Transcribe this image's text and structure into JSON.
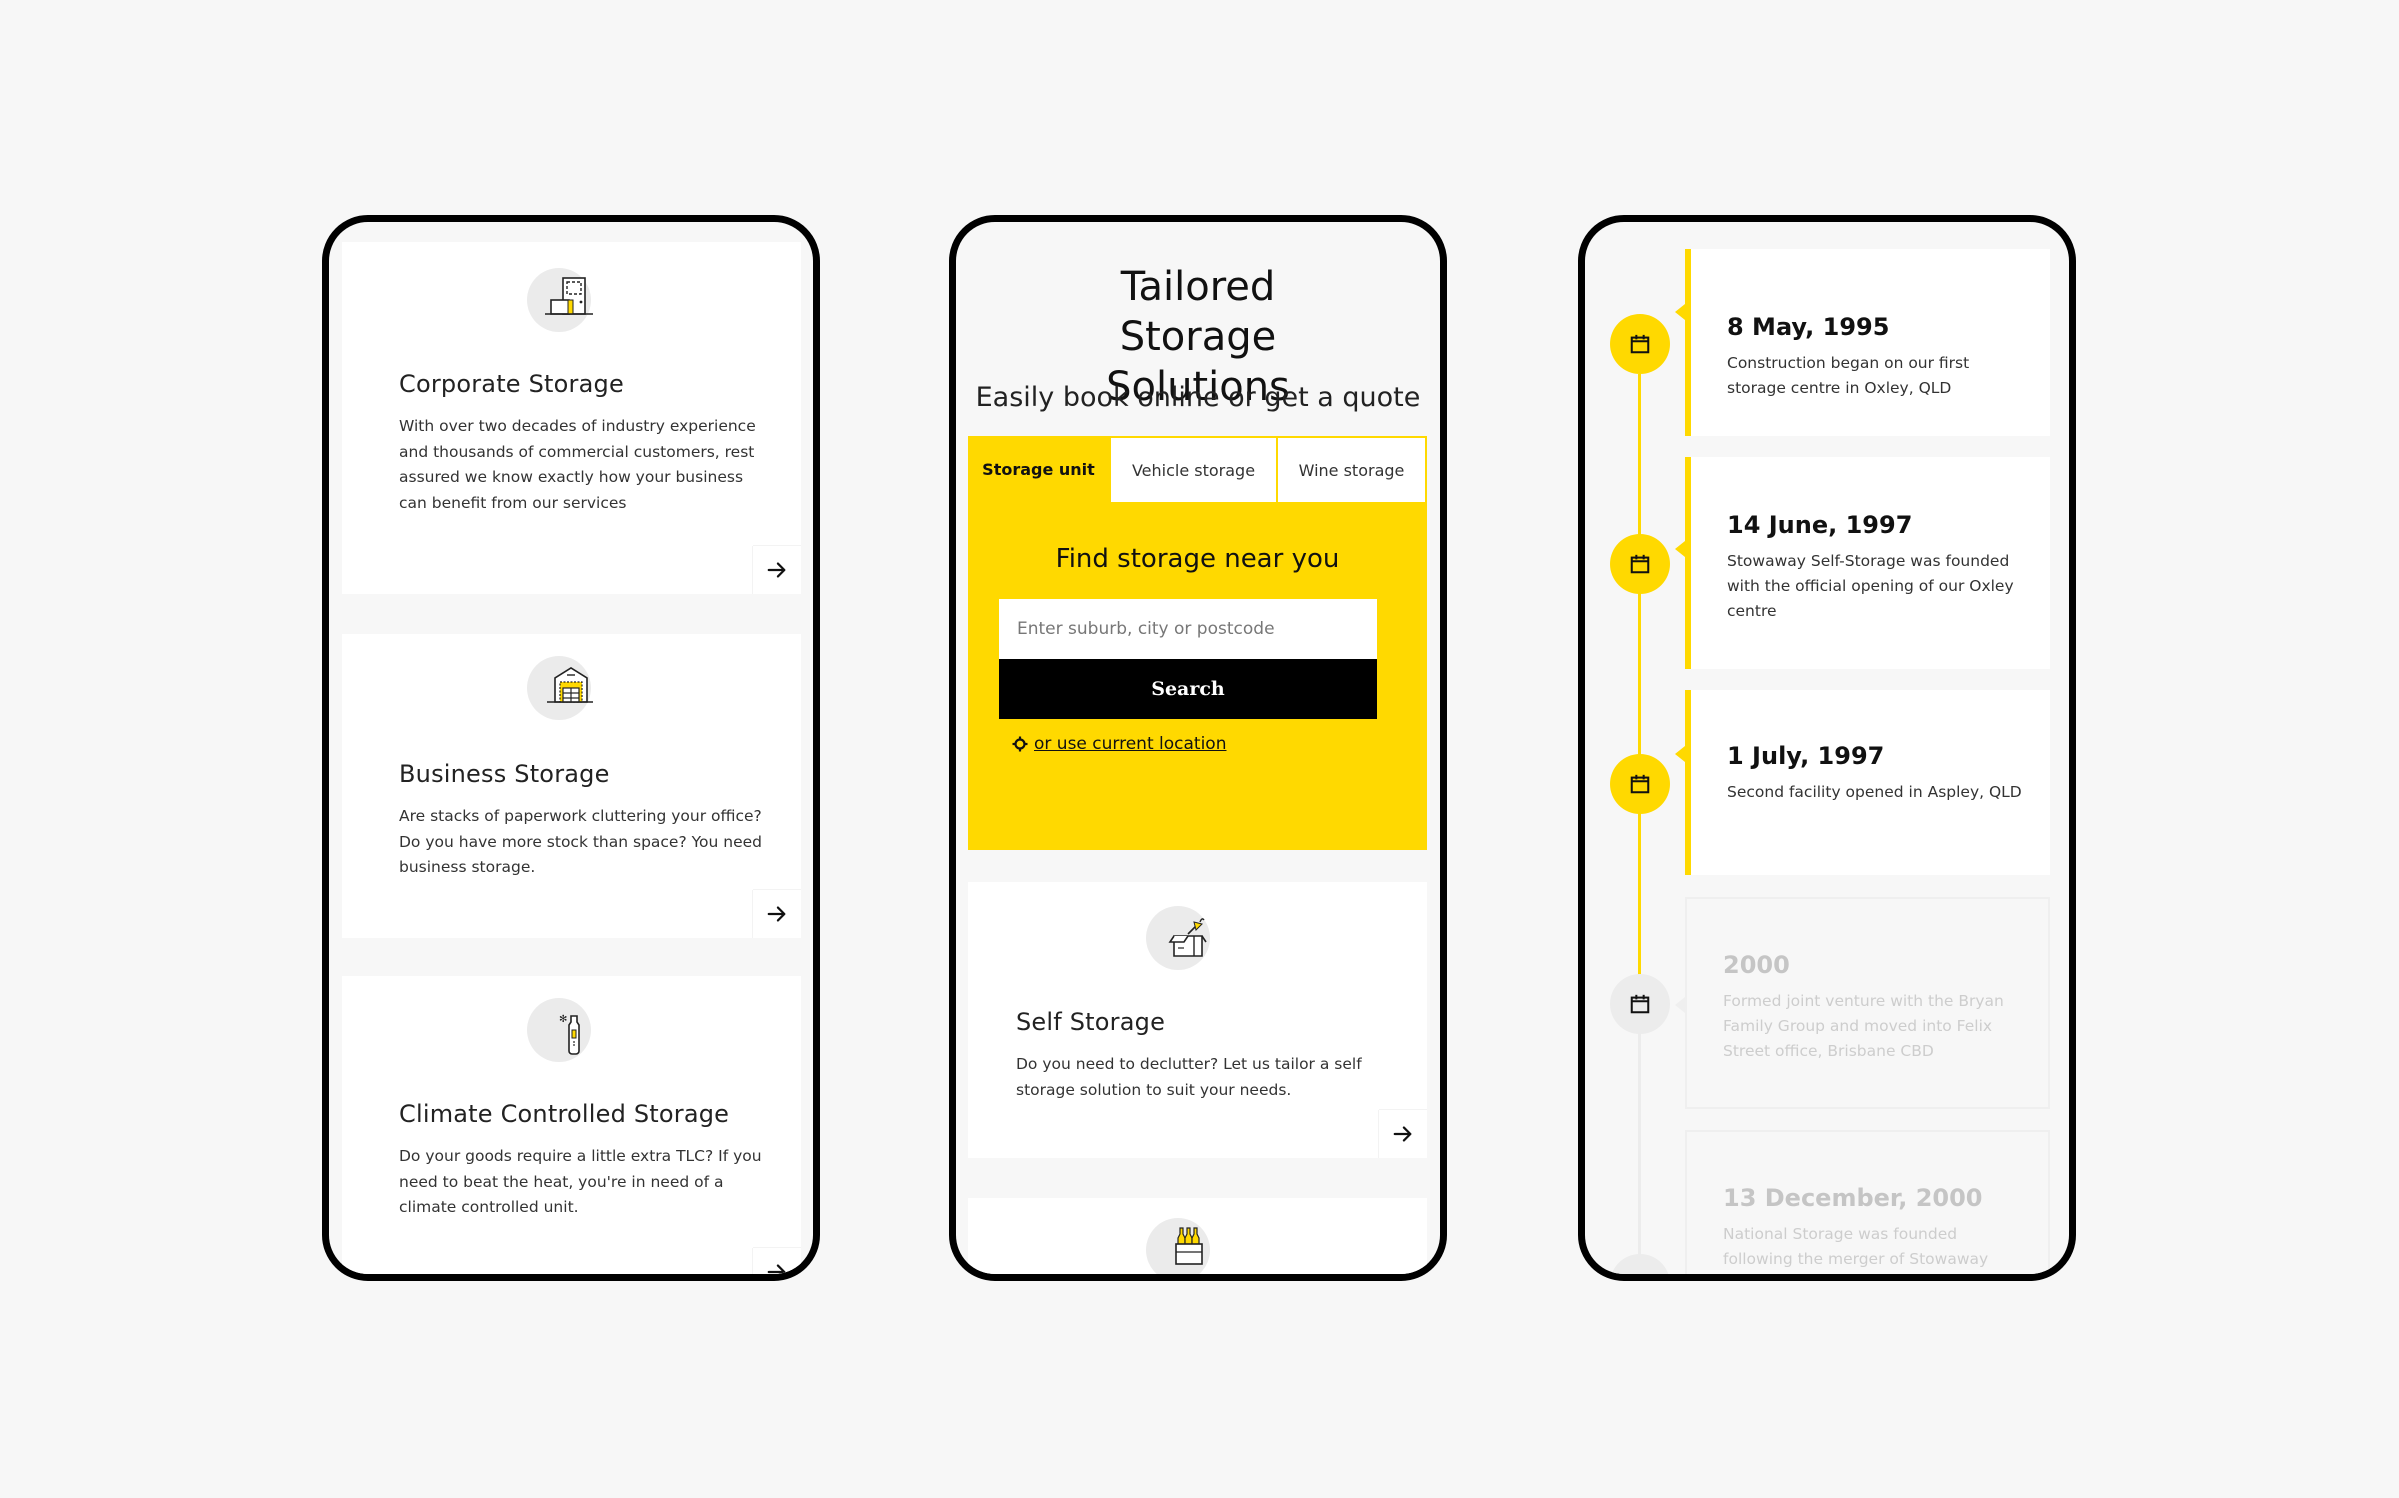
{
  "colors": {
    "accent_yellow": "#ffd900",
    "frame_black": "#000000",
    "page_bg": "#f7f7f7",
    "card_bg": "#ffffff",
    "icon_circle_bg": "#ebebeb",
    "faded_text": "#c5c5c5"
  },
  "phone_left": {
    "cards": [
      {
        "icon": "corporate-storage-icon",
        "title": "Corporate Storage",
        "description": "With over two decades of industry experience and thousands of commercial customers, rest assured we know exactly how your business can benefit from our services",
        "action_icon": "arrow-right-icon"
      },
      {
        "icon": "business-storage-icon",
        "title": "Business Storage",
        "description": "Are stacks of paperwork cluttering your office? Do you have more stock than space? You need business storage.",
        "action_icon": "arrow-right-icon"
      },
      {
        "icon": "climate-controlled-icon",
        "title": "Climate Controlled Storage",
        "description": "Do your goods require a little extra TLC? If you need to beat the heat, you're in need of a climate controlled unit.",
        "action_icon": "arrow-right-icon"
      }
    ]
  },
  "phone_mid": {
    "hero_title": "Tailored Storage Solutions",
    "hero_subtitle": "Easily book online or get a quote",
    "tabs": [
      {
        "label": "Storage unit",
        "active": true
      },
      {
        "label": "Vehicle storage",
        "active": false
      },
      {
        "label": "Wine storage",
        "active": false
      }
    ],
    "find_title": "Find storage near you",
    "search_placeholder": "Enter suburb, city or postcode",
    "search_value": "",
    "search_button": "Search",
    "location_link": " or use current location",
    "location_icon": "crosshair-icon",
    "cards": [
      {
        "icon": "self-storage-icon",
        "title": "Self Storage",
        "description": "Do you need to declutter? Let us tailor a self storage solution to suit your needs.",
        "action_icon": "arrow-right-icon"
      },
      {
        "icon": "wine-storage-icon"
      }
    ]
  },
  "phone_right": {
    "timeline": [
      {
        "date": "8 May, 1995",
        "text": "Construction began on our first storage centre in Oxley, QLD",
        "state": "active",
        "icon": "calendar-icon"
      },
      {
        "date": "14 June, 1997",
        "text": "Stowaway Self-Storage was founded with the official opening of our Oxley centre",
        "state": "active",
        "icon": "calendar-icon"
      },
      {
        "date": "1 July, 1997",
        "text": "Second facility opened in Aspley, QLD",
        "state": "active",
        "icon": "calendar-icon"
      },
      {
        "date": "2000",
        "text": "Formed joint venture with the Bryan Family Group and moved into Felix Street office, Brisbane CBD",
        "state": "faded",
        "icon": "calendar-icon"
      },
      {
        "date": "13 December, 2000",
        "text": "National Storage was founded following the merger of Stowaway",
        "state": "faded",
        "icon": "calendar-icon"
      }
    ]
  }
}
